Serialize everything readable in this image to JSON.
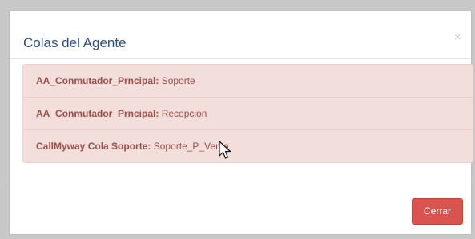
{
  "modal": {
    "title": "Colas del Agente",
    "close_symbol": "×"
  },
  "queues": [
    {
      "name": "AA_Conmutador_Prncipal:",
      "value": "Soporte"
    },
    {
      "name": "AA_Conmutador_Prncipal:",
      "value": "Recepcion"
    },
    {
      "name": "CallMyway Cola Soporte:",
      "value": "Soporte_P_Venta"
    }
  ],
  "footer": {
    "close_label": "Cerrar"
  },
  "icons": {
    "cursor": "mouse-pointer-icon"
  },
  "colors": {
    "title": "#2f4f7f",
    "alert_bg": "#f2dedb",
    "alert_text": "#9a4f49",
    "button_bg": "#d9534f",
    "button_text": "#ffffff"
  }
}
